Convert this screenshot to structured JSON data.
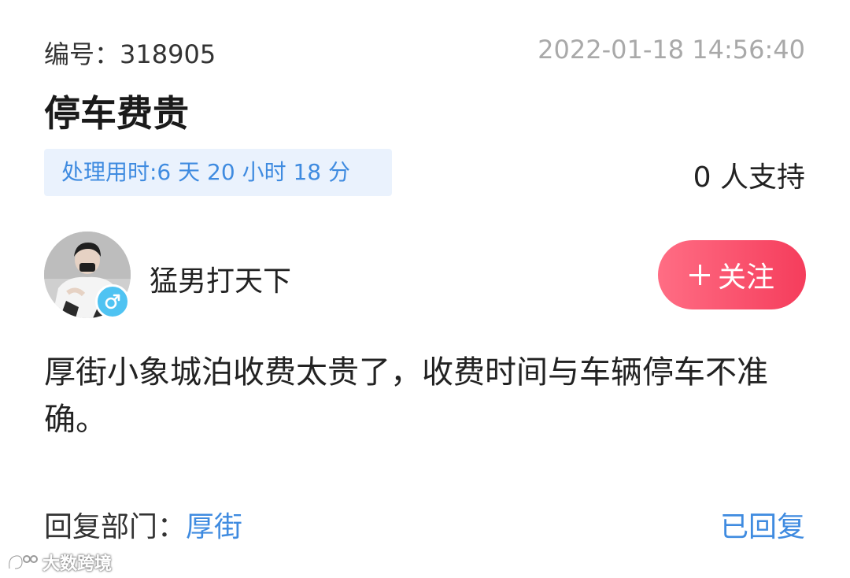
{
  "header": {
    "id_label": "编号：",
    "id_value": "318905",
    "timestamp": "2022-01-18 14:56:40"
  },
  "title": "停车费贵",
  "duration": "处理用时:6 天 20 小时 18 分",
  "support": "0 人支持",
  "user": {
    "name": "猛男打天下",
    "gender_icon": "male-icon",
    "accent": "#4fc3f2"
  },
  "follow_button": {
    "label": "关注",
    "icon": "plus-icon",
    "color": "#f53d5c"
  },
  "content": "厚街小象城泊收费太贵了，收费时间与车辆停车不准确。",
  "footer": {
    "reply_dept_label": "回复部门：",
    "reply_dept_value": "厚街",
    "reply_status": "已回复",
    "link_color": "#3f8be0"
  },
  "watermark": {
    "text": "大数跨境"
  }
}
